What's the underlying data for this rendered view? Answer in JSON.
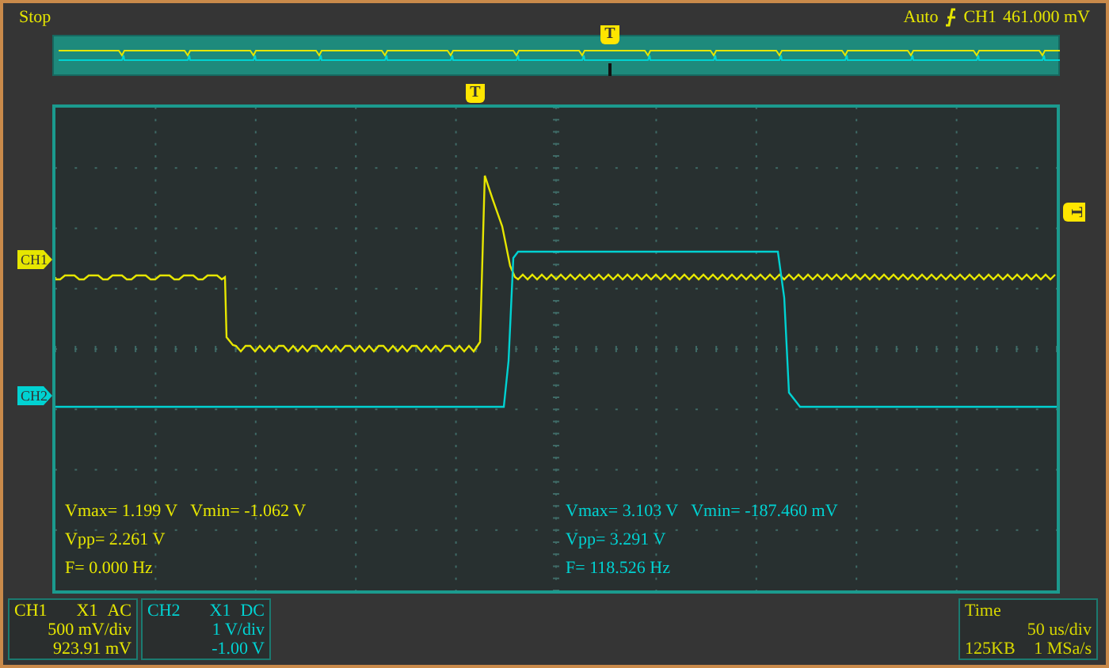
{
  "status": "Stop",
  "trigger": {
    "mode": "Auto",
    "source": "CH1",
    "level": "461.000 mV"
  },
  "markers": {
    "overview_trigger": "T",
    "trigger_position": "T",
    "trigger_level": "T"
  },
  "channels": [
    {
      "name": "CH1",
      "marker_label": "CH1",
      "probe": "X1",
      "coupling": "AC",
      "scale": "500 mV/div",
      "offset": "923.91 mV",
      "color": "#e6e600",
      "measurements": [
        [
          "Vmax= 1.199 V",
          "Vmin= -1.062 V"
        ],
        [
          "Vpp= 2.261 V"
        ],
        [
          "F= 0.000 Hz"
        ]
      ]
    },
    {
      "name": "CH2",
      "marker_label": "CH2",
      "probe": "X1",
      "coupling": "DC",
      "scale": "1 V/div",
      "offset": "-1.00 V",
      "color": "#00d2d2",
      "measurements": [
        [
          "Vmax= 3.103 V",
          "Vmin= -187.460 mV"
        ],
        [
          "Vpp= 3.291 V"
        ],
        [
          "F= 118.526 Hz"
        ]
      ]
    }
  ],
  "timebase": {
    "label": "Time",
    "scale": "50 us/div",
    "memory": "125KB",
    "rate": "1 MSa/s"
  }
}
